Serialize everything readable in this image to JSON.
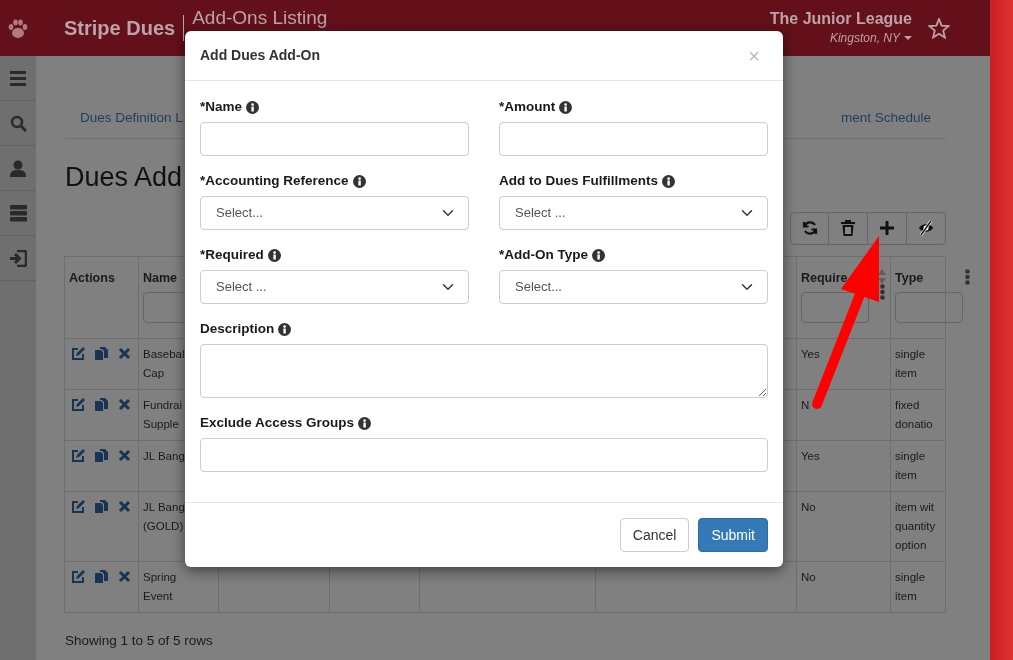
{
  "header": {
    "brand": "Stripe Dues",
    "page_title": "Add-Ons Listing",
    "org_name": "The Junior League",
    "location": "Kingston, NY"
  },
  "tabs": [
    {
      "label": "Dues Definition L"
    },
    {
      "label": "ment Schedule"
    }
  ],
  "page_heading": "Dues Add",
  "table": {
    "columns": [
      {
        "label": "Actions",
        "filter": false,
        "sort": false,
        "menu": false
      },
      {
        "label": "Name",
        "filter": true,
        "sort": false,
        "menu": false
      },
      {
        "label": "Require",
        "filter": true,
        "sort": true,
        "menu": true
      },
      {
        "label": "Type",
        "filter": true,
        "sort": false,
        "menu": true
      }
    ],
    "rows": [
      {
        "name": [
          "Basebal",
          "Cap"
        ],
        "required": "Yes",
        "type": [
          "single",
          "item"
        ]
      },
      {
        "name": [
          "Fundrai",
          "Supple"
        ],
        "required": "N",
        "type": [
          "fixed",
          "donatio"
        ]
      },
      {
        "name": [
          "JL Bang"
        ],
        "required": "Yes",
        "type": [
          "single",
          "item"
        ]
      },
      {
        "name": [
          "JL Bang",
          "(GOLD)"
        ],
        "required": "No",
        "type": [
          "item wit",
          "quantity",
          "option"
        ]
      },
      {
        "name": [
          "Spring",
          "Event"
        ],
        "required": "No",
        "type": [
          "single",
          "item"
        ]
      }
    ]
  },
  "footer_text": "Showing 1 to 5 of 5 rows",
  "modal": {
    "title": "Add Dues Add-On",
    "close": "×",
    "fields": [
      {
        "label": "*Name",
        "kind": "input",
        "wide": false
      },
      {
        "label": "*Amount",
        "kind": "input",
        "wide": false
      },
      {
        "label": "*Accounting Reference",
        "kind": "select",
        "value": "Select...",
        "wide": false
      },
      {
        "label": "Add to Dues Fulfillments",
        "kind": "select",
        "value": "Select ...",
        "wide": false
      },
      {
        "label": "*Required",
        "kind": "select",
        "value": "Select ...",
        "wide": false
      },
      {
        "label": "*Add-On Type",
        "kind": "select",
        "value": "Select...",
        "wide": false
      },
      {
        "label": "Description",
        "kind": "textarea",
        "wide": true
      },
      {
        "label": "Exclude Access Groups",
        "kind": "input",
        "wide": true
      }
    ],
    "buttons": [
      {
        "label": "Cancel",
        "kind": "secondary"
      },
      {
        "label": "Submit",
        "kind": "primary"
      }
    ]
  }
}
